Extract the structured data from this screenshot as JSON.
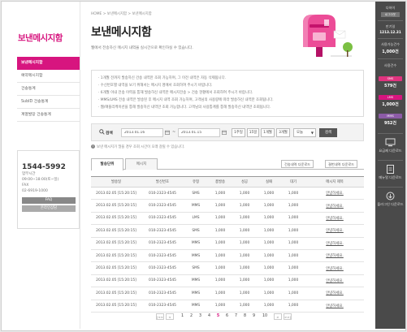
{
  "sidebar": {
    "brand": "보낸메시지함",
    "menu": [
      {
        "label": "보낸메시지함",
        "active": true
      },
      {
        "label": "예약메시지함",
        "active": false
      },
      {
        "label": "건송통계",
        "active": false
      },
      {
        "label": "SubID 건송통계",
        "active": false
      },
      {
        "label": "계열발망 건송통계",
        "active": false
      }
    ],
    "cs": {
      "phone": "1544-5992",
      "hours_label": "업무시간",
      "hours": "09:00~18:00(토~일)",
      "fax_label": "FAX",
      "fax": "02-6919-1000",
      "faq": "FAQ",
      "online": "온라인상담"
    }
  },
  "header": {
    "breadcrumb": "HOME > 보낸메시지함 > 보낸메시지함",
    "title": "보낸메시지함",
    "subtitle": "웹에서 전송하신 메시지 내역을 실시간으로 확인하실 수 있습니다."
  },
  "notices": [
    "1개월 전까지 발송하신 건송 내역만 조회 가능하며, 그 이전 내역은 자동 삭제됩니다.",
    "수신번호별 내역을 보기 위해서는 메시지 명에서 조회하여 주시기 바랍니다.",
    "6개월 이내 전송 이력을 통해 발송하신 내역만 메시지전송 > 건송 현황에서 조회하여 주시기 바랍니다.",
    "MMS/LMS 전송 내역은 발송된 후 메시지 내역 조회 가능하며, 고객님의 사용량에 따라 발송하신 내역만 조회됩니다.",
    "웹/애플리케이션을 통해 발송하신 내역만 조회 가능합니다. 고객님의 사용통계를 통해 발송하신 내역만 조회됩니다."
  ],
  "search": {
    "label": "검색",
    "date_from": "2013.01.16",
    "date_to": "2013.01.15",
    "tilde": "~",
    "periods": [
      "1주일",
      "15일",
      "1개월",
      "3개월"
    ],
    "select_value": "오늘",
    "button": "검색"
  },
  "hint": "보낸 메시지가 많을 경우 조회 시간이 오래 걸릴 수 있습니다.",
  "tabs": [
    "발송단위",
    "메시지"
  ],
  "downloads": [
    "건송내역 다운로드",
    "결번내역 다운로드"
  ],
  "table": {
    "headers": [
      "발송일",
      "발신번호",
      "유형",
      "총발송",
      "성공",
      "실패",
      "대기",
      "메시지 제목"
    ],
    "rows": [
      [
        "2013.02.05 [15:20:15]",
        "010-2323-4545",
        "SMS",
        "1,000",
        "1,000",
        "1,000",
        "1,000",
        "안녕하세요."
      ],
      [
        "2013.02.05 [15:20:15]",
        "010-2323-4545",
        "MMS",
        "1,000",
        "1,000",
        "1,000",
        "1,000",
        "안녕하세요."
      ],
      [
        "2013.02.05 [15:20:15]",
        "010-2323-4545",
        "LMS",
        "1,000",
        "1,000",
        "1,000",
        "1,000",
        "안녕하세요."
      ],
      [
        "2013.02.05 [15:20:15]",
        "010-2323-4545",
        "SMS",
        "1,000",
        "1,000",
        "1,000",
        "1,000",
        "안녕하세요."
      ],
      [
        "2013.02.05 [15:20:15]",
        "010-2323-4545",
        "MMS",
        "1,000",
        "1,000",
        "1,000",
        "1,000",
        "안녕하세요."
      ],
      [
        "2013.02.05 [15:20:15]",
        "010-2323-4545",
        "MMS",
        "1,000",
        "1,000",
        "1,000",
        "1,000",
        "안녕하세요."
      ],
      [
        "2013.02.05 [15:20:15]",
        "010-2323-4545",
        "SMS",
        "1,000",
        "1,000",
        "1,000",
        "1,000",
        "안녕하세요."
      ],
      [
        "2013.02.05 [15:20:15]",
        "010-2323-4545",
        "MMS",
        "1,000",
        "1,000",
        "1,000",
        "1,000",
        "안녕하세요."
      ],
      [
        "2013.02.05 [15:20:15]",
        "010-2323-4545",
        "MMS",
        "1,000",
        "1,000",
        "1,000",
        "1,000",
        "안녕하세요."
      ],
      [
        "2013.02.05 [15:20:15]",
        "010-2323-4545",
        "MMS",
        "1,000",
        "1,000",
        "1,000",
        "1,000",
        "안녕하세요."
      ]
    ]
  },
  "pagination": {
    "first": "|<<",
    "prev": "<",
    "pages": [
      "1",
      "2",
      "3",
      "4",
      "5",
      "6",
      "7",
      "8",
      "9",
      "10"
    ],
    "current": "5",
    "next": ">",
    "last": ">>|"
  },
  "right_panel": {
    "user": "다하이",
    "logout": "로그아웃",
    "expire_label": "만기일",
    "expire_date": "1213.12.31",
    "usage_label": "사용가능건수",
    "usage_value": "1,000",
    "usage_unit": "건",
    "charge_label": "사용건수",
    "badges": [
      {
        "label": "SMS",
        "value": "579건",
        "color": "#e0337f"
      },
      {
        "label": "LMS",
        "value": "1,000건",
        "color": "#d7157f"
      },
      {
        "label": "MMS",
        "value": "952건",
        "color": "#8c5ba7"
      }
    ],
    "links": [
      "요금제 다운로드",
      "메뉴얼 다운로드",
      "플러그인 다운로드"
    ]
  },
  "colors": {
    "accent": "#d7157f",
    "panel": "#4a4a4a"
  }
}
